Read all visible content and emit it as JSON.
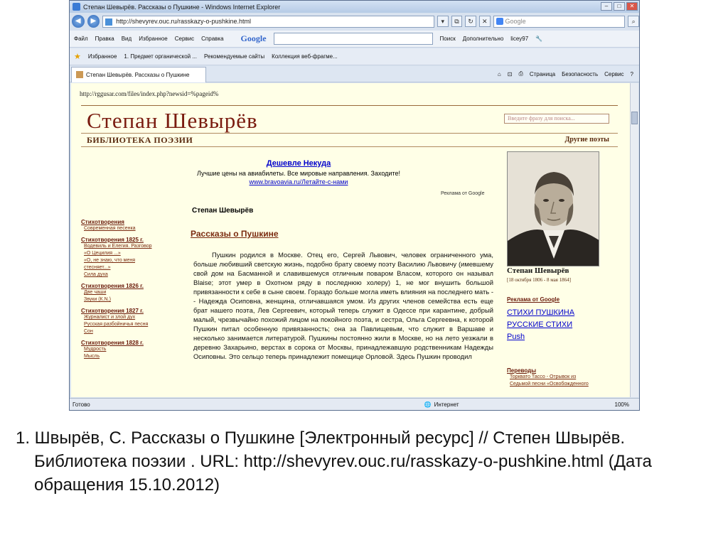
{
  "window": {
    "title": "Степан Шевырёв. Рассказы о Пушкине - Windows Internet Explorer",
    "controls": [
      "–",
      "□",
      "✕"
    ]
  },
  "address": {
    "url": "http://shevyrev.ouc.ru/rasskazy-o-pushkine.html",
    "search_placeholder": "Google"
  },
  "menu": {
    "items": [
      "Файл",
      "Правка",
      "Вид",
      "Избранное",
      "Сервис",
      "Справка"
    ],
    "google_label": "Google",
    "search_btn": "Поиск",
    "more": "Дополнительно",
    "user": "licey97"
  },
  "favorites": {
    "label": "Избранное",
    "items": [
      "1. Предмет органической ...",
      "Рекомендуемые сайты",
      "Коллекция веб-фрагме..."
    ]
  },
  "tab": {
    "title": "Степан Шевырёв. Рассказы о Пушкине",
    "cmds": [
      "Страница",
      "Безопасность",
      "Сервис"
    ]
  },
  "page": {
    "urltext": "http://rggusar.com/files/index.php?newsid=%pageid%",
    "site_title": "Степан Шевырёв",
    "search_placeholder": "Введите фразу для поиска...",
    "subtitle": "БИБЛИОТЕКА ПОЭЗИИ",
    "other_poets": "Другие поэты",
    "ad": {
      "title": "Дешевле Некуда",
      "desc": "Лучшие цены на авиабилеты. Все мировые направления. Заходите!",
      "url": "www.bravoavia.ru/Летайте-с-нами"
    },
    "ads_by": "Реклама от Google",
    "author": "Степан Шевырёв",
    "work_title": "Рассказы о Пушкине",
    "body": "Пушкин родился в Москве. Отец его, Сергей Львович, человек ограниченного ума, больше любивший светскую жизнь, подобно брату своему поэту Василию Львовичу (имевшему свой дом на Басманной и славившемуся отличным поваром Власом, которого он называл Blaise; этот умер в Охотном ряду в последнюю холеру) 1, не мог внушить большой привязанности к себе в сыне своем. Гораздо больше могла иметь влияния на последнего мать -- Надежда Осиповна, женщина, отличавшаяся умом. Из других членов семейства есть еще брат нашего поэта, Лев Сергеевич, который теперь служит в Одессе при карантине, добрый малый, чрезвычайно похожий лицом на покойного поэта, и сестра, Ольга Сергеевна, к которой Пушкин питал особенную привязанность; она за Павлищевым, что служит в Варшаве и несколько занимается литературой. Пушкины постоянно жили в Москве, но на лето уезжали в деревню Захарьино, верстах в сорока от Москвы, принадлежавшую родственникам Надежды Осиповны. Это сельцо теперь принадлежит помещице Орловой. Здесь Пушкин проводил",
    "leftnav": [
      {
        "h": "Стихотворения",
        "items": [
          "Современная песенка"
        ]
      },
      {
        "h": "Стихотворения 1825 г.",
        "items": [
          "Водевиль и Елегия. Разговор",
          "«О Цецилия ...»",
          "«О, не знаю, что меня",
          "стесняет...»",
          "Сила духа"
        ]
      },
      {
        "h": "Стихотворения 1826 г.",
        "items": [
          "Две чаши",
          "Звуки (К.N.)"
        ]
      },
      {
        "h": "Стихотворения 1827 г.",
        "items": [
          "Журналист и злой дух",
          "Русская разбойничья песня",
          "Сон"
        ]
      },
      {
        "h": "Стихотворения 1828 г.",
        "items": [
          "Мудрость",
          "Мысль"
        ]
      }
    ],
    "caption": "Степан Шевырёв",
    "caption_dates": "[18 октября 1806 - 8 мая 1864]",
    "right_ads_header": "Реклама от Google",
    "right_ads": [
      "СТИХИ ПУШКИНА",
      "РУССКИЕ СТИХИ",
      "Push"
    ],
    "trans_header": "Переводы",
    "trans_items": [
      "Торквато Тассо - Отрывок из",
      "Седьмой песни «Освобожденного"
    ]
  },
  "status": {
    "ready": "Готово",
    "zone": "Интернет",
    "zoom": "100%"
  },
  "citation": "1. Швырёв, С. Рассказы о Пушкине  [Электронный ресурс] // Степен Швырёв. Библиотека поэзии . URL: http://shevyrev.ouc.ru/rasskazy-o-pushkine.html (Дата обращения 15.10.2012)"
}
